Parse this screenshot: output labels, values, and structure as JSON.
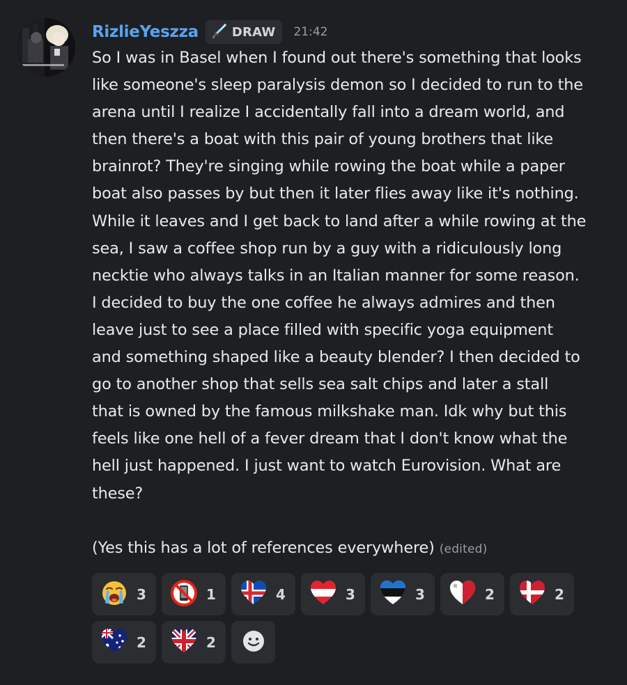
{
  "message": {
    "author": "RizlieYeszza",
    "tag_label": "DRAW",
    "tag_icon": "sword-icon",
    "timestamp": "21:42",
    "lines": [
      "So I was in Basel when I found out there's something that looks",
      "like someone's sleep paralysis demon so I decided to run to the",
      "arena until I realize I accidentally fall into a dream world, and",
      "then there's a boat with this pair of young brothers that like",
      "brainrot? They're singing while rowing the boat while a paper",
      "boat also passes by but then it later flies away like it's nothing.",
      "While it leaves and I get back to land after a while rowing at the",
      "sea, I saw a coffee shop run by a guy with a ridiculously long",
      "necktie who always talks in an Italian manner for some reason.",
      "I decided to buy the one coffee he always admires and then",
      "leave just to see a place filled with specific yoga equipment",
      "and something shaped like a beauty blender? I then decided to",
      "go to another shop that sells sea salt chips and later a stall",
      "that is owned by the famous milkshake man. Idk why but this",
      "feels like one hell of a fever dream that I don't know what the",
      "hell just happened. I just want to watch Eurovision. What are",
      "these?"
    ],
    "footnote": "(Yes this has a lot of references everywhere)",
    "edited_label": "(edited)"
  },
  "reactions": [
    {
      "emoji": "loudly-crying-face",
      "count": "3"
    },
    {
      "emoji": "no-mobile-phones",
      "count": "1"
    },
    {
      "emoji": "iceland-heart",
      "count": "4"
    },
    {
      "emoji": "austria-heart",
      "count": "3"
    },
    {
      "emoji": "estonia-heart",
      "count": "3"
    },
    {
      "emoji": "malta-heart",
      "count": "2"
    },
    {
      "emoji": "denmark-heart",
      "count": "2"
    },
    {
      "emoji": "australia-heart",
      "count": "2"
    },
    {
      "emoji": "uk-heart",
      "count": "2"
    }
  ],
  "colors": {
    "background": "#1e1f23",
    "username": "#5aa3ee",
    "reaction_bg": "#2b2d31"
  }
}
